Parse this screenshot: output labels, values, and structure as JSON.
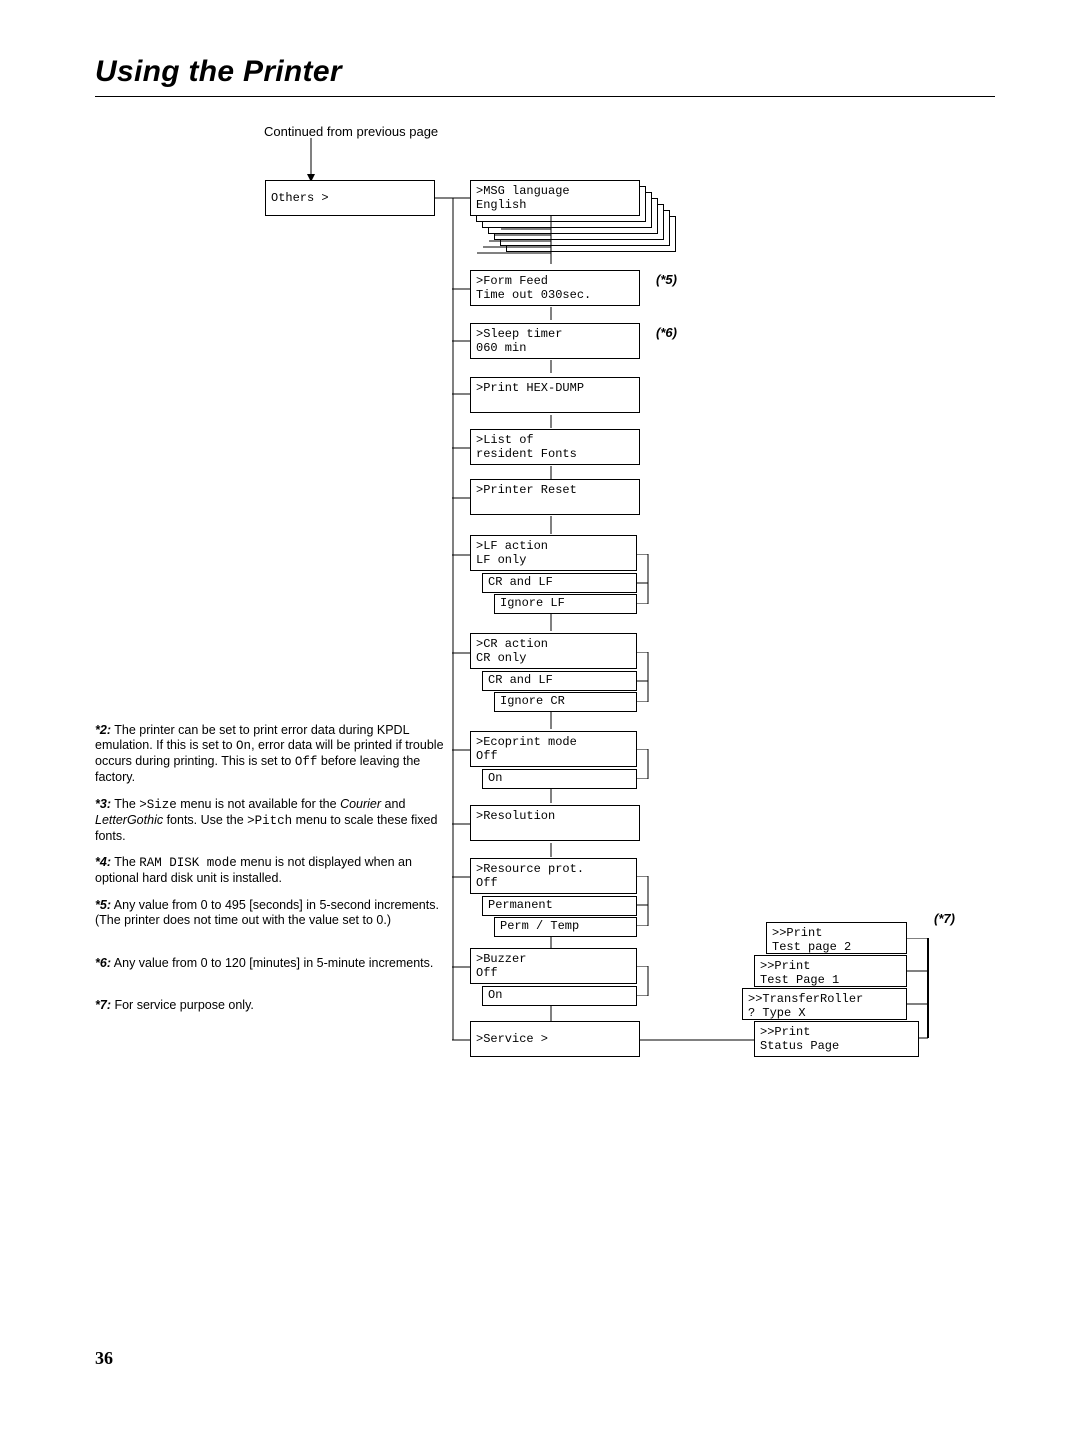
{
  "title": "Using the Printer",
  "continued": "Continued from previous page",
  "page_number": "36",
  "boxes": {
    "others": "Others                >",
    "msg1": ">MSG language",
    "msg2": "         English",
    "form1": ">Form Feed",
    "form2": "Time out    030sec.",
    "sleep1": ">Sleep timer",
    "sleep2": "          060 min",
    "hex": ">Print HEX-DUMP",
    "list1": ">List of",
    "list2": " resident Fonts",
    "preset": ">Printer Reset",
    "lf1": ">LF action",
    "lf2": "  LF only",
    "lf3": "  CR and LF",
    "lf4": "  Ignore LF",
    "cr1": ">CR action",
    "cr2": "  CR only",
    "cr3": "  CR and LF",
    "cr4": "  Ignore CR",
    "eco1": ">Ecoprint mode",
    "eco2": "  Off",
    "eco3": "  On",
    "res": ">Resolution",
    "resp1": ">Resource prot.",
    "resp2": "  Off",
    "resp3": "  Permanent",
    "resp4": "  Perm / Temp",
    "buz1": ">Buzzer",
    "buz2": "  Off",
    "buz3": "  On",
    "service": ">Service            >",
    "sp1": ">>Print",
    "sp2": " Status Page",
    "tr1": ">>TransferRoller",
    "tr2": "? Type X",
    "tp11": ">>Print",
    "tp12": "Test Page 1",
    "tp21": ">>Print",
    "tp22": "Test page 2"
  },
  "notes": {
    "n2_key": "*2:",
    "n2_a": "The printer can be set to print error data during KPDL emulation. If this is set to ",
    "n2_code1": "On",
    "n2_b": ", error data will be printed if trouble occurs during printing. This is set to ",
    "n2_code2": "Off",
    "n2_c": " before leaving the factory.",
    "n3_key": "*3:",
    "n3_a": "The ",
    "n3_code1": ">Size",
    "n3_b": " menu is not available for the ",
    "n3_ital1": "Courier",
    "n3_c": " and ",
    "n3_ital2": "LetterGothic",
    "n3_d": " fonts. Use the ",
    "n3_code2": ">Pitch",
    "n3_e": " menu to scale these fixed fonts.",
    "n4_key": "*4:",
    "n4_a": "The ",
    "n4_code1": "RAM DISK mode",
    "n4_b": " menu is not displayed when an optional hard disk unit is installed.",
    "n5_key": "*5:",
    "n5": "Any value from 0 to 495 [seconds] in 5-second increments. (The printer does not time out with the value set to 0.)",
    "n6_key": "*6:",
    "n6": "Any value from 0 to 120 [minutes] in 5-minute increments.",
    "n7_key": "*7:",
    "n7": "For service purpose only."
  },
  "refs": {
    "r5": "(*5)",
    "r6": "(*6)",
    "r7": "(*7)"
  }
}
